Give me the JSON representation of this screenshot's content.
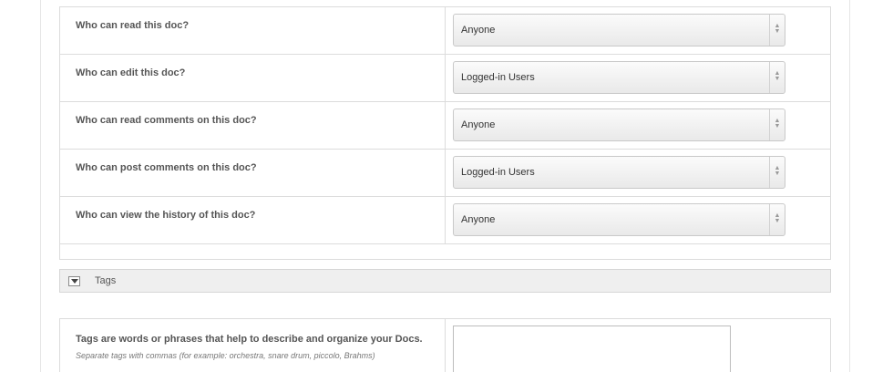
{
  "permissions": {
    "rows": [
      {
        "label": "Who can read this doc?",
        "value": "Anyone"
      },
      {
        "label": "Who can edit this doc?",
        "value": "Logged-in Users"
      },
      {
        "label": "Who can read comments on this doc?",
        "value": "Anyone"
      },
      {
        "label": "Who can post comments on this doc?",
        "value": "Logged-in Users"
      },
      {
        "label": "Who can view the history of this doc?",
        "value": "Anyone"
      }
    ]
  },
  "tags": {
    "title": "Tags",
    "toggle_icon": "triangle-down-icon",
    "description": "Tags are words or phrases that help to describe and organize your Docs.",
    "hint": "Separate tags with commas (for example: orchestra, snare drum, piccolo, Brahms)",
    "value": ""
  },
  "select_arrow_glyph": "▲▼",
  "colors": {
    "border": "#dcdcdc",
    "label_text": "#555555",
    "header_bg": "#efefef"
  }
}
